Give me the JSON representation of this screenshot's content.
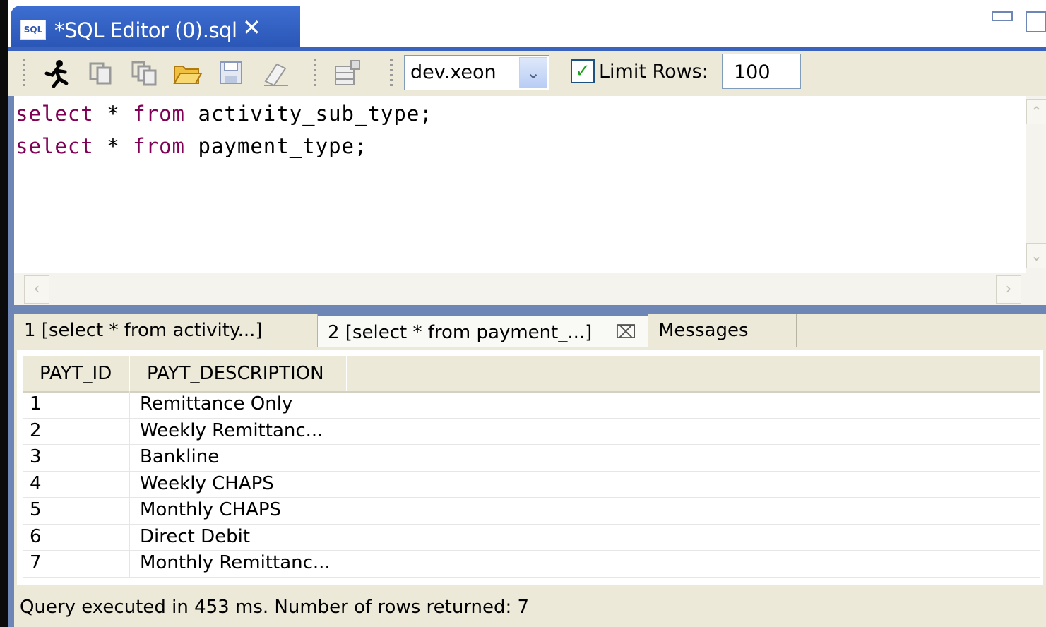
{
  "editor_tab": {
    "icon": "sql-file-icon",
    "title": "*SQL Editor (0).sql",
    "close": "✕"
  },
  "toolbar": {
    "connection": "dev.xeon",
    "limit_rows_checked": true,
    "limit_rows_label": "Limit Rows:",
    "limit_rows_value": "100",
    "icons": [
      "run-icon",
      "copy-icon",
      "copy-all-icon",
      "open-folder-icon",
      "save-icon",
      "eraser-icon",
      "grid-icon"
    ]
  },
  "editor": {
    "lines": [
      {
        "keyword1": "select",
        "star": "*",
        "keyword2": "from",
        "table": "activity_sub_type;"
      },
      {
        "keyword1": "select",
        "star": "*",
        "keyword2": "from",
        "table": "payment_type;"
      }
    ]
  },
  "result_tabs": [
    {
      "label": "1 [select * from activity...]",
      "active": false
    },
    {
      "label": "2 [select * from payment_...]",
      "active": true
    },
    {
      "label": "Messages",
      "active": false
    }
  ],
  "results": {
    "columns": [
      "PAYT_ID",
      "PAYT_DESCRIPTION"
    ],
    "rows": [
      [
        "1",
        "Remittance Only"
      ],
      [
        "2",
        "Weekly Remittanc..."
      ],
      [
        "3",
        "Bankline"
      ],
      [
        "4",
        "Weekly CHAPS"
      ],
      [
        "5",
        "Monthly CHAPS"
      ],
      [
        "6",
        "Direct Debit"
      ],
      [
        "7",
        "Monthly Remittanc..."
      ]
    ]
  },
  "status": "Query executed in 453 ms.  Number of rows returned: 7"
}
